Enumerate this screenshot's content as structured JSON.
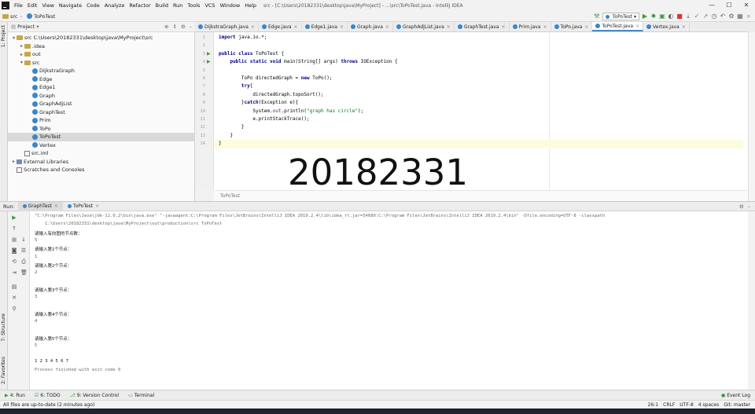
{
  "menubar": {
    "items": [
      "File",
      "Edit",
      "View",
      "Navigate",
      "Code",
      "Analyze",
      "Refactor",
      "Build",
      "Run",
      "Tools",
      "VCS",
      "Window",
      "Help"
    ],
    "window_title": "src - [C:\\Users\\20182331\\desktop\\java\\MyProject] - ...\\src\\ToPoTest.java - IntelliJ IDEA"
  },
  "navbar": {
    "crumbs": [
      "src",
      "ToPoTest"
    ],
    "run_config": "ToPoTest"
  },
  "project_panel": {
    "title": "Project",
    "rows": [
      {
        "label": "src  C:\\Users\\20182331\\desktop\\java\\MyProject\\src",
        "indent": 0,
        "arrow": "▾",
        "icon": "folder"
      },
      {
        "label": ".idea",
        "indent": 1,
        "arrow": "▸",
        "icon": "folder"
      },
      {
        "label": "out",
        "indent": 1,
        "arrow": "▸",
        "icon": "folder"
      },
      {
        "label": "src",
        "indent": 1,
        "arrow": "▾",
        "icon": "folder"
      },
      {
        "label": "DijkstraGraph",
        "indent": 2,
        "arrow": "",
        "icon": "class"
      },
      {
        "label": "Edge",
        "indent": 2,
        "arrow": "",
        "icon": "class"
      },
      {
        "label": "Edge1",
        "indent": 2,
        "arrow": "",
        "icon": "class"
      },
      {
        "label": "Graph",
        "indent": 2,
        "arrow": "",
        "icon": "class"
      },
      {
        "label": "GraphAdjList",
        "indent": 2,
        "arrow": "",
        "icon": "class"
      },
      {
        "label": "GraphTest",
        "indent": 2,
        "arrow": "",
        "icon": "class"
      },
      {
        "label": "Prim",
        "indent": 2,
        "arrow": "",
        "icon": "class"
      },
      {
        "label": "ToPo",
        "indent": 2,
        "arrow": "",
        "icon": "class"
      },
      {
        "label": "ToPoTest",
        "indent": 2,
        "arrow": "",
        "icon": "class",
        "selected": true
      },
      {
        "label": "Vertex",
        "indent": 2,
        "arrow": "",
        "icon": "class"
      },
      {
        "label": "src.iml",
        "indent": 1,
        "arrow": "",
        "icon": "file"
      },
      {
        "label": "External Libraries",
        "indent": 0,
        "arrow": "▸",
        "icon": "lib"
      },
      {
        "label": "Scratches and Consoles",
        "indent": 0,
        "arrow": "",
        "icon": "scratch"
      }
    ]
  },
  "editor_tabs": [
    "DijkstraGraph.java",
    "Edge.java",
    "Edge1.java",
    "Graph.java",
    "GraphAdjList.java",
    "GraphTest.java",
    "Prim.java",
    "ToPo.java",
    "ToPoTest.java",
    "Vertex.java"
  ],
  "active_tab_index": 8,
  "code": {
    "lines": [
      {
        "n": "1",
        "html": "<span class=\"kw\">import</span> java.io.*;"
      },
      {
        "n": "2",
        "html": ""
      },
      {
        "n": "3",
        "html": "<span class=\"kw\">public class</span> ToPoTest {",
        "run": true
      },
      {
        "n": "4",
        "html": "    <span class=\"kw\">public static void</span> main(String[] args) <span class=\"kw\">throws</span> IOException {",
        "run": true
      },
      {
        "n": "5",
        "html": ""
      },
      {
        "n": "6",
        "html": "        ToPo directedGraph = <span class=\"kw\">new</span> ToPo();"
      },
      {
        "n": "7",
        "html": "        <span class=\"kw\">try</span>{"
      },
      {
        "n": "8",
        "html": "            directedGraph.topoSort();"
      },
      {
        "n": "9",
        "html": "        }<span class=\"kw\">catch</span>(Exception e){"
      },
      {
        "n": "10",
        "html": "            System.<span class=\"fld\">out</span>.println(<span class=\"str\">\"graph has circle\"</span>);"
      },
      {
        "n": "11",
        "html": "            e.printStackTrace();"
      },
      {
        "n": "12",
        "html": "        }"
      },
      {
        "n": "13",
        "html": "    }"
      },
      {
        "n": "14",
        "html": "}",
        "caret": true
      }
    ],
    "breadcrumb": "ToPoTest"
  },
  "watermark": "20182331",
  "run_panel": {
    "label": "Run:",
    "tabs": [
      "GraphTest",
      "ToPoTest"
    ],
    "active_tab": 0
  },
  "console": {
    "lines": [
      {
        "text": "\"C:\\Program Files\\Java\\jdk-12.0.2\\bin\\java.exe\" \"-javaagent:C:\\Program Files\\JetBrains\\IntelliJ IDEA 2019.2.4\\lib\\idea_rt.jar=54680:C:\\Program Files\\JetBrains\\IntelliJ IDEA 2019.2.4\\bin\" -Dfile.encoding=UTF-8 -classpath",
        "cls": "gray"
      },
      {
        "text": "    C:\\Users\\20182331\\desktop\\java\\MyProject\\out\\production\\src ToPoTest",
        "cls": "gray"
      },
      {
        "text": "请输入有向图的节点数：",
        "cls": ""
      },
      {
        "text": "5",
        "cls": "green"
      },
      {
        "text": "请输入第1个节点：",
        "cls": ""
      },
      {
        "text": "1",
        "cls": "green"
      },
      {
        "text": "请输入第2个节点：",
        "cls": ""
      },
      {
        "text": "2",
        "cls": "green"
      },
      {
        "text": "",
        "cls": ""
      },
      {
        "text": "请输入第3个节点：",
        "cls": ""
      },
      {
        "text": "3",
        "cls": "green"
      },
      {
        "text": "",
        "cls": ""
      },
      {
        "text": "请输入第4个节点：",
        "cls": ""
      },
      {
        "text": "4",
        "cls": "green"
      },
      {
        "text": "",
        "cls": ""
      },
      {
        "text": "请输入第5个节点：",
        "cls": ""
      },
      {
        "text": "5",
        "cls": "green"
      },
      {
        "text": "",
        "cls": ""
      },
      {
        "text": "1 2 3 4 5 6 7",
        "cls": ""
      },
      {
        "text": "Process finished with exit code 0",
        "cls": "gray"
      }
    ]
  },
  "bottom_tabs": [
    "4: Run",
    "6: TODO",
    "9: Version Control",
    "Terminal"
  ],
  "event_log": "Event Log",
  "status": {
    "message": "All files are up-to-date (2 minutes ago)",
    "position": "26:1",
    "line_sep": "CRLF",
    "encoding": "UTF-8",
    "indent": "4 spaces",
    "git": "Git: master"
  },
  "colors": {
    "accent": "#4a88c7",
    "run_green": "#3a9a3a",
    "class_icon": "#3a86c8"
  }
}
